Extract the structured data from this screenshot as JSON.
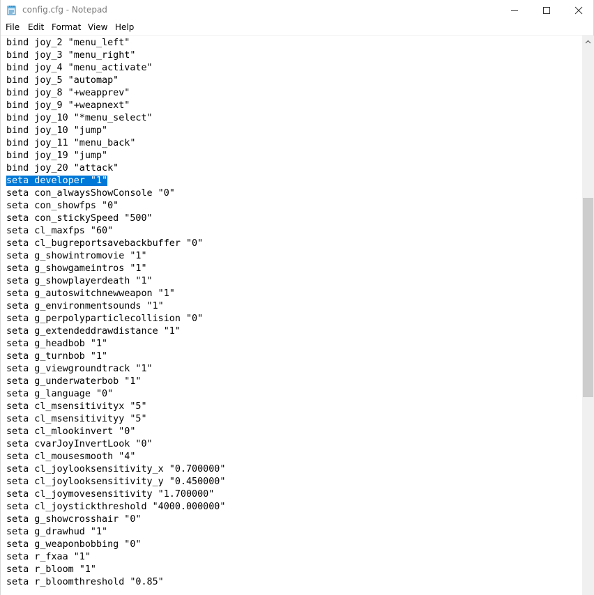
{
  "window": {
    "title": "config.cfg - Notepad"
  },
  "menu": {
    "items": [
      "File",
      "Edit",
      "Format",
      "View",
      "Help"
    ]
  },
  "editor": {
    "selected_line": 11,
    "lines": [
      "bind joy_2 \"menu_left\"",
      "bind joy_3 \"menu_right\"",
      "bind joy_4 \"menu_activate\"",
      "bind joy_5 \"automap\"",
      "bind joy_8 \"+weapprev\"",
      "bind joy_9 \"+weapnext\"",
      "bind joy_10 \"*menu_select\"",
      "bind joy_10 \"jump\"",
      "bind joy_11 \"menu_back\"",
      "bind joy_19 \"jump\"",
      "bind joy_20 \"attack\"",
      "seta developer \"1\"",
      "seta con_alwaysShowConsole \"0\"",
      "seta con_showfps \"0\"",
      "seta con_stickySpeed \"500\"",
      "seta cl_maxfps \"60\"",
      "seta cl_bugreportsavebackbuffer \"0\"",
      "seta g_showintromovie \"1\"",
      "seta g_showgameintros \"1\"",
      "seta g_showplayerdeath \"1\"",
      "seta g_autoswitchnewweapon \"1\"",
      "seta g_environmentsounds \"1\"",
      "seta g_perpolyparticlecollision \"0\"",
      "seta g_extendeddrawdistance \"1\"",
      "seta g_headbob \"1\"",
      "seta g_turnbob \"1\"",
      "seta g_viewgroundtrack \"1\"",
      "seta g_underwaterbob \"1\"",
      "seta g_language \"0\"",
      "seta cl_msensitivityx \"5\"",
      "seta cl_msensitivityy \"5\"",
      "seta cl_mlookinvert \"0\"",
      "seta cvarJoyInvertLook \"0\"",
      "seta cl_mousesmooth \"4\"",
      "seta cl_joylooksensitivity_x \"0.700000\"",
      "seta cl_joylooksensitivity_y \"0.450000\"",
      "seta cl_joymovesensitivity \"1.700000\"",
      "seta cl_joystickthreshold \"4000.000000\"",
      "seta g_showcrosshair \"0\"",
      "seta g_drawhud \"1\"",
      "seta g_weaponbobbing \"0\"",
      "seta r_fxaa \"1\"",
      "seta r_bloom \"1\"",
      "seta r_bloomthreshold \"0.85\""
    ]
  },
  "colors": {
    "selection": "#0078d7",
    "selection_text": "#ffffff",
    "title_text": "#7a7a7a"
  }
}
